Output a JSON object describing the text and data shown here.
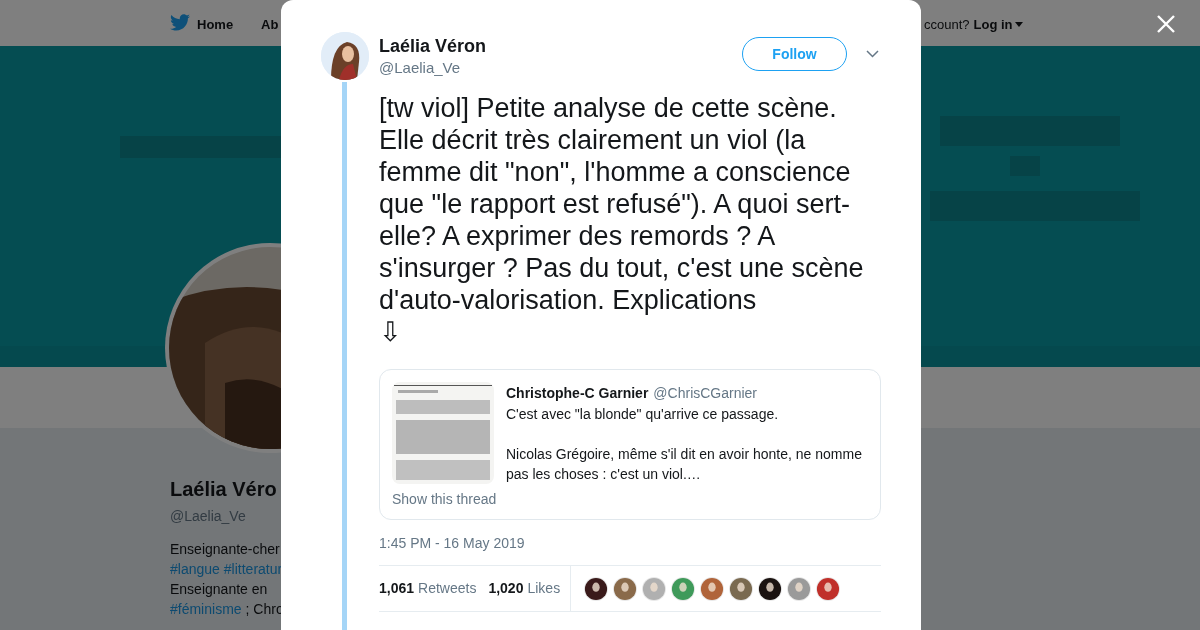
{
  "background": {
    "nav": {
      "home": "Home",
      "about": "Ab",
      "account_prompt": "ccount?",
      "login": "Log in"
    },
    "profile": {
      "name": "Laélia Véro",
      "handle": "@Laelia_Ve",
      "bio": [
        [
          {
            "kind": "text",
            "text": "Enseignante-cher"
          }
        ],
        [
          {
            "kind": "hashtag",
            "text": "#langue"
          },
          {
            "kind": "hashtag",
            "text": "#litteratur"
          }
        ],
        [
          {
            "kind": "text",
            "text": "Enseignante en"
          }
        ],
        [
          {
            "kind": "hashtag",
            "text": "#féminisme"
          },
          {
            "kind": "text",
            "text": "; Chro"
          }
        ]
      ]
    }
  },
  "tweet": {
    "author": {
      "name": "Laélia Véron",
      "handle": "@Laelia_Ve"
    },
    "follow": "Follow",
    "text": "[tw viol] Petite analyse de cette scène. Elle décrit très clairement un viol (la femme dit \"non\", l'homme a conscience que \"le rapport est refusé\"). A quoi sert-elle? A exprimer des remords ? A s'insurger ? Pas du tout, c'est une scène d'auto-valorisation. Explications\n⇩",
    "quote": {
      "name": "Christophe-C Garnier",
      "handle": "@ChrisCGarnier",
      "paragraphs": [
        "C'est avec \"la blonde\" qu'arrive ce passage.",
        "Nicolas Grégoire, même s'il dit en avoir honte, ne nomme pas les choses : c'est un viol.…"
      ],
      "show_thread": "Show this thread"
    },
    "timestamp": "1:45 PM - 16 May 2019",
    "stats": [
      {
        "count": "1,061",
        "label": "Retweets"
      },
      {
        "count": "1,020",
        "label": "Likes"
      }
    ],
    "likers": [
      {
        "color": "#3a1a1a"
      },
      {
        "color": "#8a6a4a"
      },
      {
        "color": "#b0b0b0"
      },
      {
        "color": "#3f9a5a"
      },
      {
        "color": "#b0643a"
      },
      {
        "color": "#7a6a50"
      },
      {
        "color": "#1a1210"
      },
      {
        "color": "#9a9a9a"
      },
      {
        "color": "#c0302a"
      }
    ]
  }
}
